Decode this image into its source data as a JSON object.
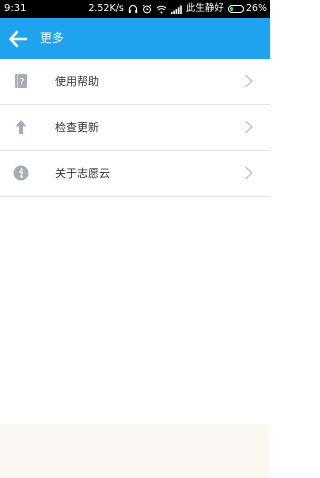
{
  "status_bar": {
    "time": "9:31",
    "network_speed": "2.52K/s",
    "carrier": "此生静好",
    "battery_percent": "26%",
    "battery_level": 0.26,
    "battery_color": "#4cd964"
  },
  "app_bar": {
    "title": "更多",
    "back_icon": "arrow-left-icon",
    "background_color": "#1fa3ee"
  },
  "menu": {
    "items": [
      {
        "label": "使用帮助",
        "icon": "help-icon"
      },
      {
        "label": "检查更新",
        "icon": "arrow-up-icon"
      },
      {
        "label": "关于志愿云",
        "icon": "info-icon"
      }
    ]
  }
}
